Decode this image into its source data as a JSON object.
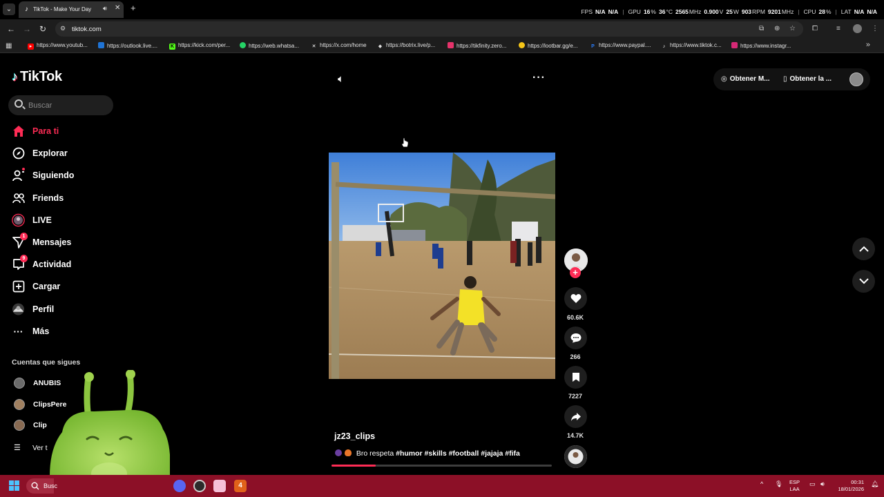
{
  "browser": {
    "tab_title": "TikTok - Make Your Day",
    "url": "tiktok.com",
    "bookmarks": [
      "https://www.youtub...",
      "https://outlook.live....",
      "https://kick.com/per...",
      "https://web.whatsa...",
      "https://x.com/home",
      "https://botrix.live/p...",
      "https://tikfinity.zero...",
      "https://lootbar.gg/e...",
      "https://www.paypal....",
      "https://www.tiktok.c...",
      "https://www.instagr..."
    ]
  },
  "overlay": {
    "fps_label": "FPS",
    "fps1": "N/A",
    "fps2": "N/A",
    "gpu_label": "GPU",
    "gpu_util": "16",
    "gpu_util_unit": "%",
    "gpu_temp": "36",
    "gpu_temp_unit": "°C",
    "gpu_clock": "2565",
    "gpu_clock_unit": "MHz",
    "gpu_volt": "0.900",
    "gpu_volt_unit": "V",
    "gpu_power": "25",
    "gpu_power_unit": "W",
    "fan": "903",
    "fan_unit": "RPM",
    "mem_clock": "9201",
    "mem_clock_unit": "MHz",
    "cpu_label": "CPU",
    "cpu_util": "28",
    "cpu_util_unit": "%",
    "lat_label": "LAT",
    "lat1": "N/A",
    "lat2": "N/A"
  },
  "tiktok": {
    "logo": "TikTok",
    "search_placeholder": "Buscar",
    "nav": [
      {
        "label": "Para ti",
        "icon": "home-icon",
        "active": true
      },
      {
        "label": "Explorar",
        "icon": "compass-icon"
      },
      {
        "label": "Siguiendo",
        "icon": "following-icon"
      },
      {
        "label": "Friends",
        "icon": "friends-icon"
      },
      {
        "label": "LIVE",
        "icon": "live-icon"
      },
      {
        "label": "Mensajes",
        "icon": "messages-icon",
        "badge": "1"
      },
      {
        "label": "Actividad",
        "icon": "activity-icon",
        "badge": "9"
      },
      {
        "label": "Cargar",
        "icon": "upload-icon"
      },
      {
        "label": "Perfil",
        "icon": "profile-icon"
      },
      {
        "label": "Más",
        "icon": "more-icon"
      }
    ],
    "following_title": "Cuentas que sigues",
    "following": [
      "ANUBIS",
      "ClipsPere",
      "Clip"
    ],
    "see_all": "Ver t",
    "top_buttons": [
      "Obtener M...",
      "Obtener la ..."
    ],
    "video": {
      "author": "jz23_clips",
      "caption_text": "Bro respeta",
      "hashtags": "#humor #skills #football #jajaja #fifa",
      "likes": "60.6K",
      "comments": "266",
      "saves": "7227",
      "shares": "14.7K",
      "progress": 0.2
    }
  },
  "taskbar": {
    "search_text": "Busc",
    "lang_top": "ESP",
    "lang_bottom": "LAA",
    "time": "00:31",
    "date": "18/01/2026"
  },
  "colors": {
    "accent": "#fe2c55",
    "taskbar": "#8c1027"
  }
}
